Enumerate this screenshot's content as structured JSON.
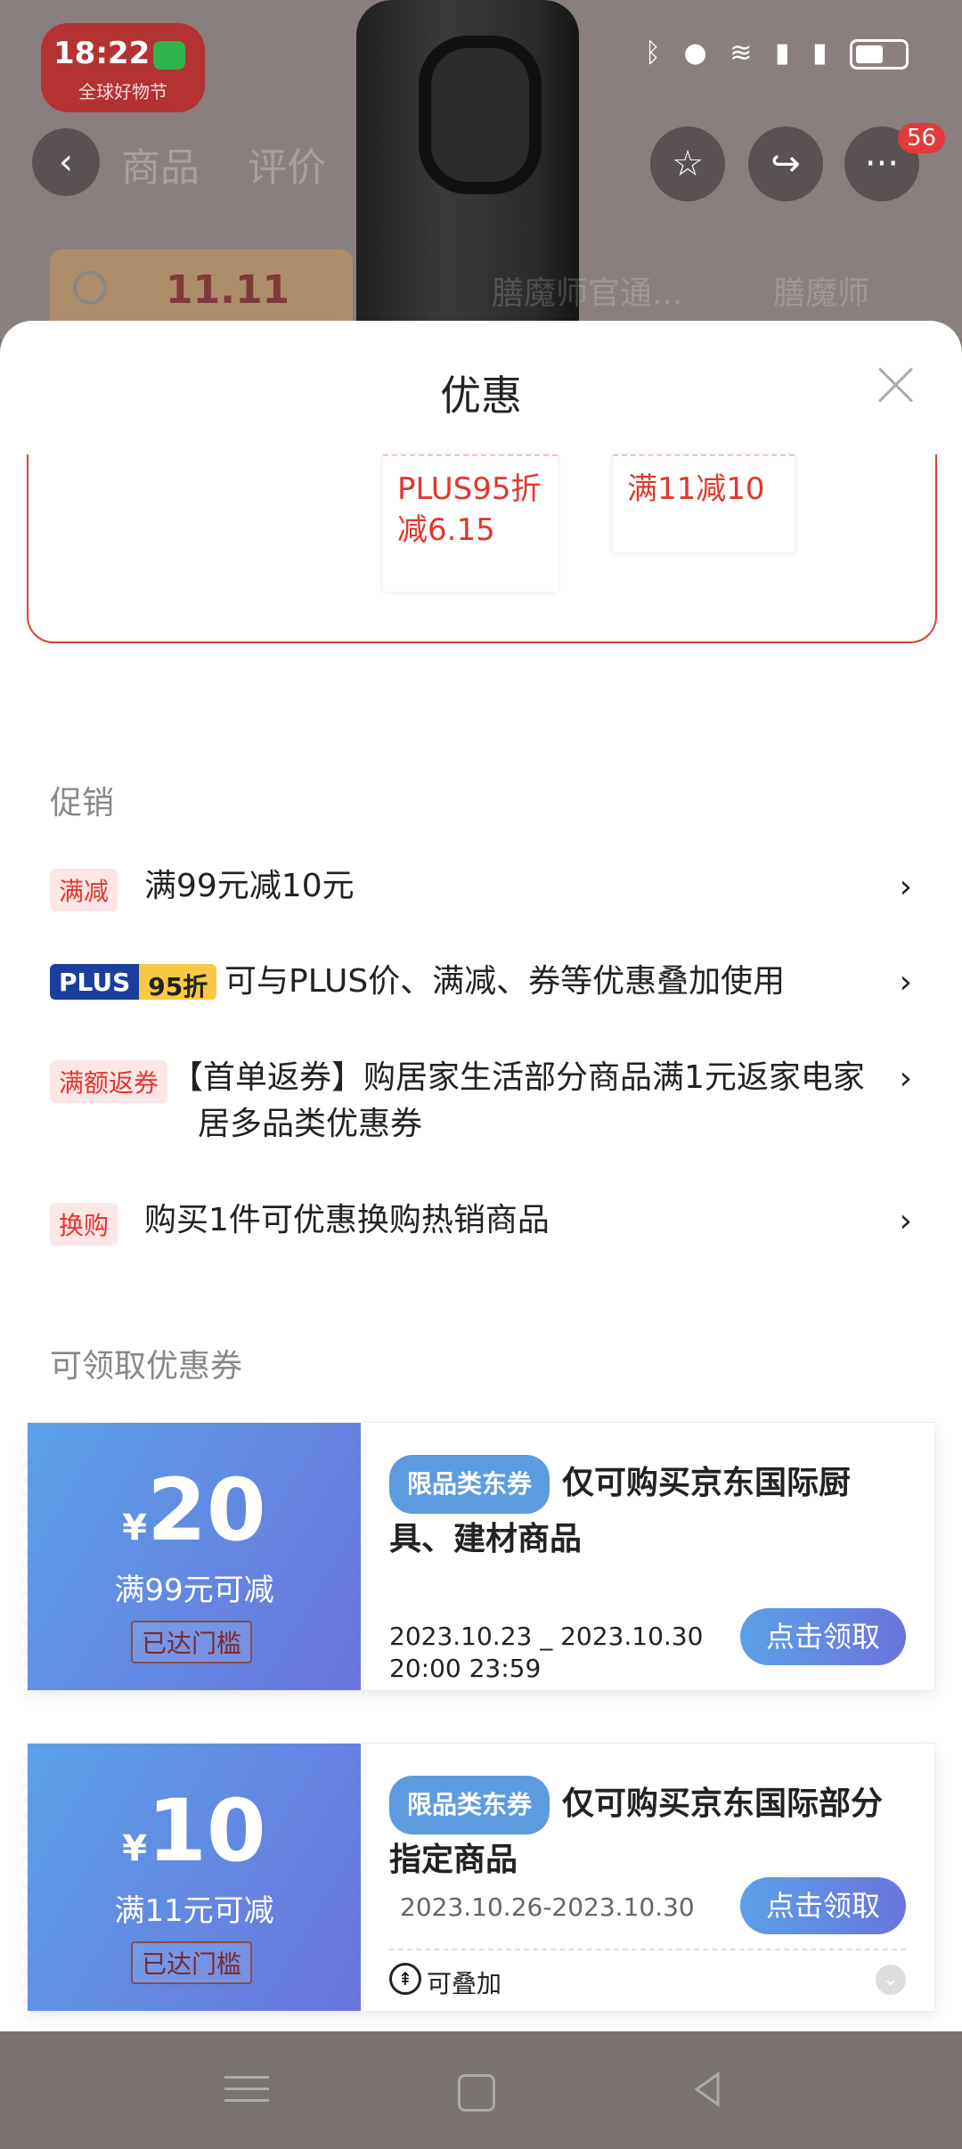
{
  "status_bar": {
    "time": "18:22",
    "icons": [
      "bluetooth-icon",
      "location-icon",
      "hd-icon",
      "wifi-icon",
      "signal-5g-icon",
      "signal-5g-icon",
      "battery-icon"
    ]
  },
  "background_page": {
    "badge_main": "11.11",
    "badge_sub": "全球好物节",
    "tabs": [
      "商品",
      "评价"
    ],
    "notification_count": "56",
    "search_text": "11.11",
    "chips": [
      "膳魔师官通...",
      "膳魔师"
    ]
  },
  "sheet": {
    "title": "优惠",
    "mini_coupons": [
      "PLUS95折减6.15",
      "满11减10"
    ],
    "promo_section_title": "促销",
    "promotions": [
      {
        "tag": "满减",
        "text": "满99元减10元"
      },
      {
        "tag": "PLUS",
        "tag2": "95折",
        "text": "可与PLUS价、满减、券等优惠叠加使用"
      },
      {
        "tag": "满额返券",
        "text": "【首单返券】购居家生活部分商品满1元返家电家居多品类优惠券"
      },
      {
        "tag": "换购",
        "text": "购买1件可优惠换购热销商品"
      }
    ],
    "coupon_section_title": "可领取优惠券",
    "coupons": [
      {
        "currency": "¥",
        "amount": "20",
        "condition": "满99元可减",
        "status": "已达门槛",
        "category_tag": "限品类东券",
        "description": "仅可购买京东国际厨具、建材商品",
        "date_line1": "2023.10.23 _ 2023.10.30",
        "date_line2": "20:00 23:59",
        "button": "点击领取"
      },
      {
        "currency": "¥",
        "amount": "10",
        "condition": "满11元可减",
        "status": "已达门槛",
        "category_tag": "限品类东券",
        "description": "仅可购买京东国际部分指定商品",
        "date": "2023.10.26-2023.10.30",
        "button": "点击领取",
        "stackable": "可叠加"
      }
    ]
  },
  "colors": {
    "accent_red": "#e2362f",
    "coupon_blue": "#5c9be0",
    "overlay": "#7b7272"
  }
}
